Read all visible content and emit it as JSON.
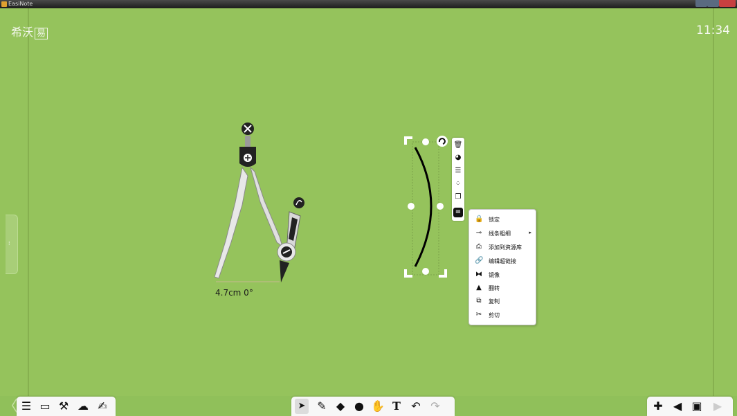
{
  "window": {
    "title": "EasiNote"
  },
  "header": {
    "logo_text": "希沃",
    "logo_boxed": "易",
    "clock": "11:34"
  },
  "canvas": {
    "compass_measure": "4.7cm 0°"
  },
  "object_toolbar": {
    "items": [
      {
        "name": "delete",
        "glyph": "🗑"
      },
      {
        "name": "palette",
        "glyph": "◕"
      },
      {
        "name": "align",
        "glyph": "☰"
      },
      {
        "name": "points",
        "glyph": "⁘"
      },
      {
        "name": "clone",
        "glyph": "❐"
      },
      {
        "name": "menu",
        "glyph": "≡"
      }
    ]
  },
  "context_menu": {
    "items": [
      {
        "label": "锁定",
        "icon": "lock-icon",
        "glyph": "🔒"
      },
      {
        "label": "线条粗细",
        "icon": "line-weight-icon",
        "glyph": "⊸",
        "submenu_glyph": "▸"
      },
      {
        "label": "添加到资源库",
        "icon": "add-to-library-icon",
        "glyph": "⎙"
      },
      {
        "label": "编辑超链接",
        "icon": "hyperlink-icon",
        "glyph": "🔗"
      },
      {
        "label": "镜像",
        "icon": "mirror-icon",
        "glyph": "⧓"
      },
      {
        "label": "翻转",
        "icon": "flip-icon",
        "glyph": "▲"
      },
      {
        "label": "复制",
        "icon": "copy-icon",
        "glyph": "⧉"
      },
      {
        "label": "剪切",
        "icon": "cut-icon",
        "glyph": "✂"
      }
    ]
  },
  "dock_left": {
    "items": [
      {
        "icon": "menu-icon",
        "glyph": "☰"
      },
      {
        "icon": "display-icon",
        "glyph": "▭"
      },
      {
        "icon": "tools-icon",
        "glyph": "⚒"
      },
      {
        "icon": "cloud-courseware-icon",
        "glyph": "☁"
      },
      {
        "icon": "handwriting-icon",
        "glyph": "✍"
      }
    ]
  },
  "dock_center": {
    "items": [
      {
        "icon": "pointer-icon",
        "glyph": "➤"
      },
      {
        "icon": "pen-icon",
        "glyph": "✎"
      },
      {
        "icon": "eraser-icon",
        "glyph": "◆"
      },
      {
        "icon": "shape-icon",
        "glyph": "●"
      },
      {
        "icon": "hand-icon",
        "glyph": "✋"
      },
      {
        "icon": "text-icon",
        "glyph": "T"
      },
      {
        "icon": "undo-icon",
        "glyph": "↶"
      },
      {
        "icon": "redo-icon",
        "glyph": "↷"
      }
    ]
  },
  "dock_right": {
    "items": [
      {
        "icon": "add-page-icon",
        "glyph": "✚"
      },
      {
        "icon": "previous-page-icon",
        "glyph": "◀"
      },
      {
        "icon": "page-number-icon",
        "glyph": "▣"
      },
      {
        "icon": "next-page-icon",
        "glyph": "▶"
      }
    ]
  }
}
